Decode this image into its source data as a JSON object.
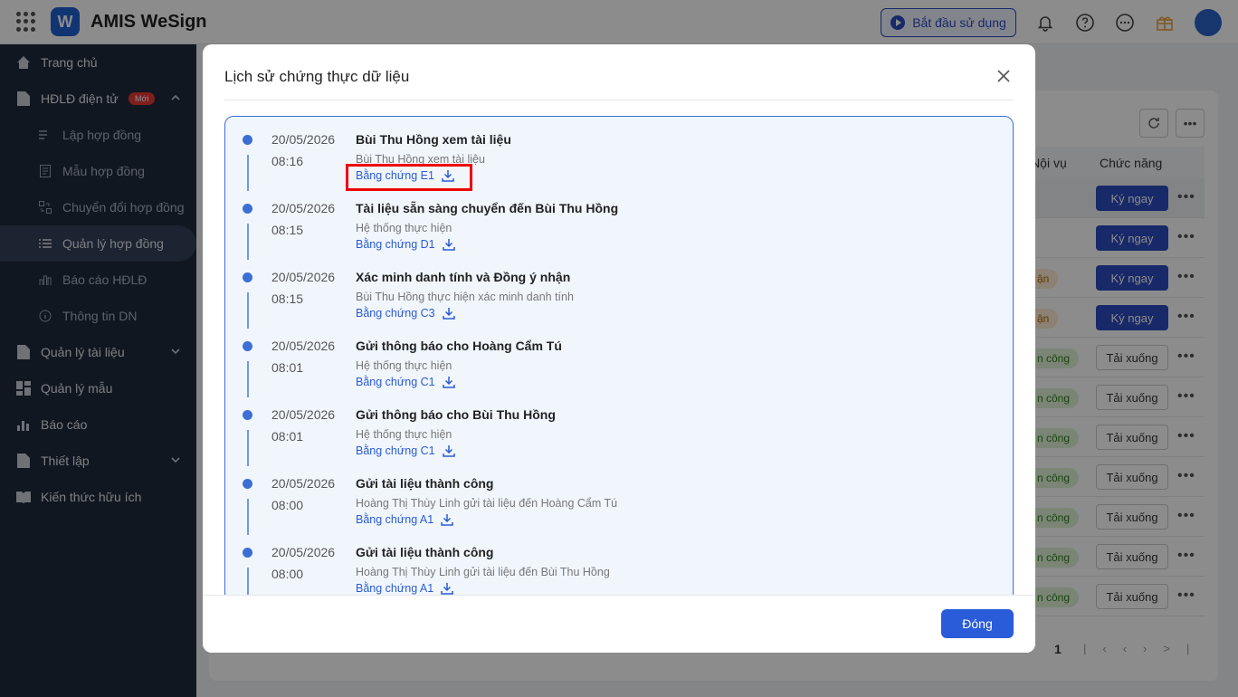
{
  "header": {
    "app_title": "AMIS WeSign",
    "logo_letter": "W",
    "start_button": "Bắt đầu sử dụng"
  },
  "sidebar": {
    "items": [
      {
        "label": "Trang chủ",
        "icon": "home-icon"
      },
      {
        "label": "HĐLĐ điện tử",
        "icon": "document-icon",
        "badge": "Mới"
      },
      {
        "label": "Lập hợp đồng",
        "icon": "list-edit-icon"
      },
      {
        "label": "Mẫu hợp đồng",
        "icon": "template-icon"
      },
      {
        "label": "Chuyển đổi hợp đồng",
        "icon": "convert-icon"
      },
      {
        "label": "Quản lý hợp đồng",
        "icon": "list-icon"
      },
      {
        "label": "Báo cáo HĐLĐ",
        "icon": "chart-icon"
      },
      {
        "label": "Thông tin DN",
        "icon": "info-icon"
      },
      {
        "label": "Quản lý tài liệu",
        "icon": "file-icon"
      },
      {
        "label": "Quản lý mẫu",
        "icon": "template-grid-icon"
      },
      {
        "label": "Báo cáo",
        "icon": "bar-chart-icon"
      },
      {
        "label": "Thiết lập",
        "icon": "settings-file-icon"
      },
      {
        "label": "Kiến thức hữu ích",
        "icon": "book-icon"
      }
    ]
  },
  "background_table": {
    "col_partial": "ơ Nội vụ",
    "col_actions": "Chức năng",
    "sign_label": "Ký ngay",
    "download_label": "Tải xuống",
    "chip_pending": "ận",
    "chip_done": "n công",
    "page_number": "1"
  },
  "modal": {
    "title": "Lịch sử chứng thực dữ liệu",
    "close_button": "Đóng",
    "timeline": [
      {
        "date": "20/05/2026",
        "time": "08:16",
        "title": "Bùi Thu Hồng xem tài liệu",
        "desc": "Bùi Thu Hồng xem tài liệu",
        "link": "Bằng chứng E1"
      },
      {
        "date": "20/05/2026",
        "time": "08:15",
        "title": "Tài liệu sẵn sàng chuyển đến Bùi Thu Hồng",
        "desc": "Hệ thống thực hiện",
        "link": "Bằng chứng D1"
      },
      {
        "date": "20/05/2026",
        "time": "08:15",
        "title": "Xác minh danh tính và Đồng ý nhận",
        "desc": "Bùi Thu Hồng thực hiện xác minh danh tính",
        "link": "Bằng chứng C3"
      },
      {
        "date": "20/05/2026",
        "time": "08:01",
        "title": "Gửi thông báo cho Hoàng Cẩm Tú",
        "desc": "Hệ thống thực hiện",
        "link": "Bằng chứng C1"
      },
      {
        "date": "20/05/2026",
        "time": "08:01",
        "title": "Gửi thông báo cho Bùi Thu Hồng",
        "desc": "Hệ thống thực hiện",
        "link": "Bằng chứng C1"
      },
      {
        "date": "20/05/2026",
        "time": "08:00",
        "title": "Gửi tài liệu thành công",
        "desc": "Hoàng Thị Thùy Linh gửi tài liệu đến Hoàng Cẩm Tú",
        "link": "Bằng chứng A1"
      },
      {
        "date": "20/05/2026",
        "time": "08:00",
        "title": "Gửi tài liệu thành công",
        "desc": "Hoàng Thị Thùy Linh gửi tài liệu đến Bùi Thu Hồng",
        "link": "Bằng chứng A1"
      }
    ]
  }
}
